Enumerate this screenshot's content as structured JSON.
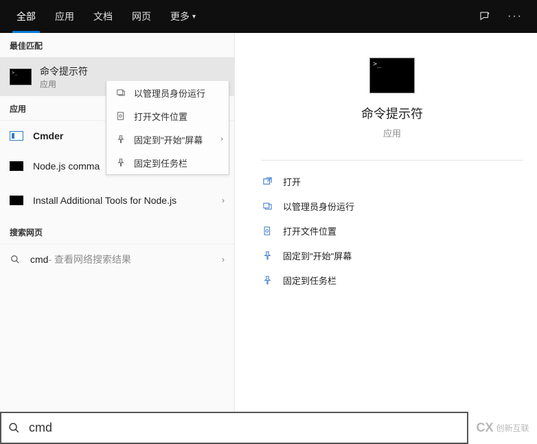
{
  "topbar": {
    "tabs": [
      "全部",
      "应用",
      "文档",
      "网页"
    ],
    "more_label": "更多"
  },
  "left": {
    "best_match_header": "最佳匹配",
    "best_match": {
      "title": "命令提示符",
      "subtitle": "应用"
    },
    "apps_header": "应用",
    "apps": [
      {
        "label": "Cmder",
        "bold": true
      },
      {
        "label": "Node.js command prompt",
        "truncated": "Node.js comma"
      },
      {
        "label": "Install Additional Tools for Node.js"
      }
    ],
    "web_header": "搜索网页",
    "web": {
      "term": "cmd",
      "hint": " - 查看网络搜索结果"
    }
  },
  "context_menu": {
    "items": [
      {
        "icon": "admin-run-icon",
        "label": "以管理员身份运行"
      },
      {
        "icon": "open-location-icon",
        "label": "打开文件位置"
      },
      {
        "icon": "pin-start-icon",
        "label": "固定到\"开始\"屏幕",
        "submenu": true
      },
      {
        "icon": "pin-taskbar-icon",
        "label": "固定到任务栏"
      }
    ]
  },
  "detail": {
    "title": "命令提示符",
    "subtitle": "应用",
    "actions": [
      {
        "icon": "open-icon",
        "label": "打开"
      },
      {
        "icon": "admin-run-icon",
        "label": "以管理员身份运行"
      },
      {
        "icon": "open-location-icon",
        "label": "打开文件位置"
      },
      {
        "icon": "pin-start-icon",
        "label": "固定到\"开始\"屏幕"
      },
      {
        "icon": "pin-taskbar-icon",
        "label": "固定到任务栏"
      }
    ]
  },
  "searchbar": {
    "value": "cmd"
  },
  "watermark": {
    "logo": "CX",
    "text": "创新互联"
  }
}
